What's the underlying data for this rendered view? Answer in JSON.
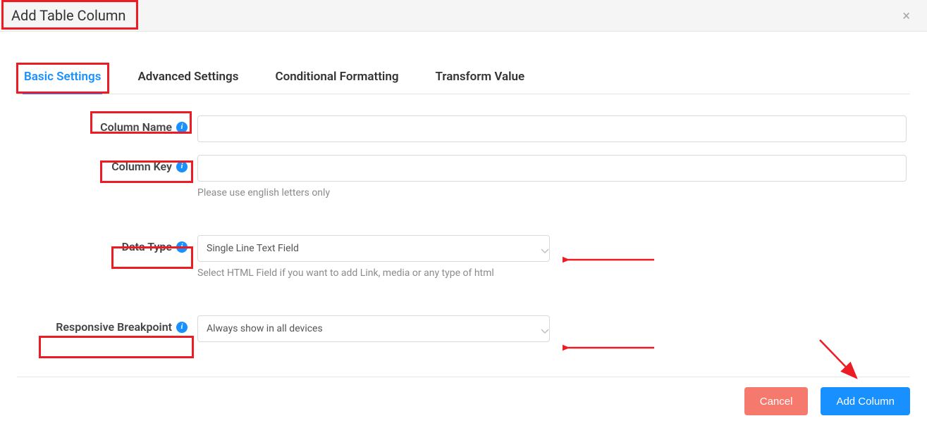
{
  "header": {
    "title": "Add Table Column"
  },
  "tabs": {
    "basic": "Basic Settings",
    "advanced": "Advanced Settings",
    "conditional": "Conditional Formatting",
    "transform": "Transform Value"
  },
  "fields": {
    "column_name": {
      "label": "Column Name",
      "value": ""
    },
    "column_key": {
      "label": "Column Key",
      "value": "",
      "helper": "Please use english letters only"
    },
    "data_type": {
      "label": "Data Type",
      "value": "Single Line Text Field",
      "helper": "Select HTML Field if you want to add Link, media or any type of html"
    },
    "responsive": {
      "label": "Responsive Breakpoint",
      "value": "Always show in all devices"
    }
  },
  "footer": {
    "cancel": "Cancel",
    "submit": "Add Column"
  }
}
